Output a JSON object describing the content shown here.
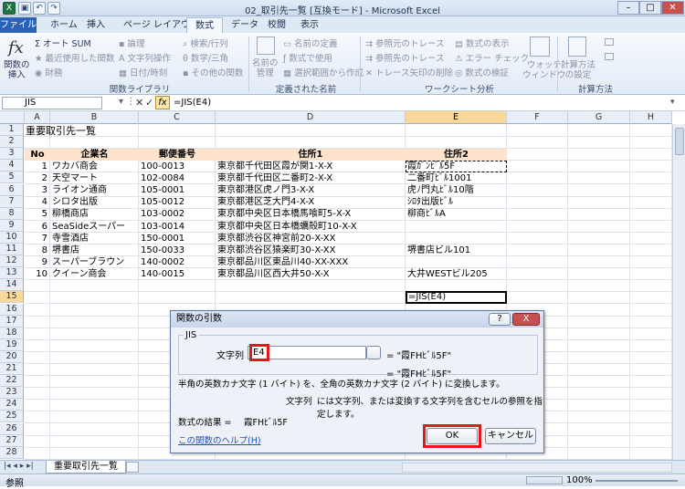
{
  "window": {
    "title": "02_取引先一覧  [互換モード]  -  Microsoft Excel"
  },
  "ribbon_tabs": [
    "ファイル",
    "ホーム",
    "挿入",
    "ページ レイアウト",
    "数式",
    "データ",
    "校閲",
    "表示"
  ],
  "ribbon": {
    "insert_function": "関数の\n挿入",
    "autosum": "オート SUM",
    "recent": "最近使用した関数",
    "financial": "財務",
    "logical": "論理",
    "text": "文字列操作",
    "datetime": "日付/時刻",
    "lookup": "検索/行列",
    "math": "数学/三角",
    "more": "その他の関数",
    "group_library": "関数ライブラリ",
    "name_manager": "名前の\n管理",
    "define_name": "名前の定義",
    "use_in_formula": "数式で使用",
    "create_from_sel": "選択範囲から作成",
    "group_names": "定義された名前",
    "trace_precedents": "参照元のトレース",
    "trace_dependents": "参照先のトレース",
    "remove_arrows": "トレース矢印の削除",
    "show_formulas": "数式の表示",
    "error_check": "エラー チェック",
    "evaluate": "数式の検証",
    "watch": "ウォッチ\nウィンドウ",
    "group_audit": "ワークシート分析",
    "calc_options": "計算方法\nの設定",
    "group_calc": "計算方法"
  },
  "formula_bar": {
    "name_box": "JIS",
    "fx": "fx",
    "formula": "=JIS(E4)"
  },
  "columns": [
    "A",
    "B",
    "C",
    "D",
    "E",
    "F",
    "G",
    "H"
  ],
  "rows": [
    "1",
    "2",
    "3",
    "4",
    "5",
    "6",
    "7",
    "8",
    "9",
    "10",
    "11",
    "12",
    "13",
    "14",
    "15",
    "16",
    "17",
    "18",
    "19",
    "20",
    "21",
    "22",
    "23",
    "24",
    "25",
    "26",
    "27",
    "28"
  ],
  "sheet": {
    "title": "重要取引先一覧",
    "headers": [
      "No",
      "企業名",
      "郵便番号",
      "住所1",
      "住所2"
    ],
    "data": [
      [
        "1",
        "ワカバ商会",
        "100-0013",
        "東京都千代田区霞が関1-X-X",
        "霞ｶﾞﾝﾋﾞﾙ5F"
      ],
      [
        "2",
        "天空マート",
        "102-0084",
        "東京都千代田区二番町2-X-X",
        "二番町ﾋﾞﾙ1001"
      ],
      [
        "3",
        "ライオン通商",
        "105-0001",
        "東京都港区虎ノ門3-X-X",
        "虎ﾉ門丸ﾋﾞﾙ10階"
      ],
      [
        "4",
        "シロタ出版",
        "105-0012",
        "東京都港区芝大門4-X-X",
        "ｼﾛﾀ出版ﾋﾞﾙ"
      ],
      [
        "5",
        "柳橋商店",
        "103-0002",
        "東京都中央区日本橋馬喰町5-X-X",
        "柳商ﾋﾞﾙA"
      ],
      [
        "6",
        "SeaSideスーパー",
        "103-0014",
        "東京都中央区日本橋蠣殻町10-X-X",
        ""
      ],
      [
        "7",
        "寺雪酒店",
        "150-0001",
        "東京都渋谷区神宮前20-X-XX",
        ""
      ],
      [
        "8",
        "堺書店",
        "150-0033",
        "東京都渋谷区猿楽町30-X-XX",
        "堺書店ビル101"
      ],
      [
        "9",
        "スーパーブラウン",
        "140-0002",
        "東京都品川区東品川40-XX-XXX",
        ""
      ],
      [
        "10",
        "クイーン商会",
        "140-0015",
        "東京都品川区西大井50-X-X",
        "大井WESTビル205"
      ]
    ],
    "e15": "=JIS(E4)"
  },
  "dialog": {
    "title": "関数の引数",
    "help_btn": "?",
    "close_btn": "X",
    "func_name": "JIS",
    "arg_label": "文字列",
    "arg_value": "E4",
    "arg_result": "= \"霞FHﾋﾞﾙ5F\"",
    "result_line": "= \"霞FHﾋﾞﾙ5F\"",
    "description": "半角の英数カナ文字 (1 バイト) を、全角の英数カナ文字 (2 バイト) に変換します。",
    "arg_desc_name": "文字列",
    "arg_desc": "には文字列、または変換する文字列を含むセルの参照を指定します。",
    "formula_result_label": "数式の結果 =",
    "formula_result": "霞FHﾋﾞﾙ5F",
    "help_link": "この関数のヘルプ(H)",
    "ok": "OK",
    "cancel": "キャンセル"
  },
  "sheet_tab": "重要取引先一覧",
  "status": {
    "mode": "参照",
    "zoom": "100%"
  }
}
